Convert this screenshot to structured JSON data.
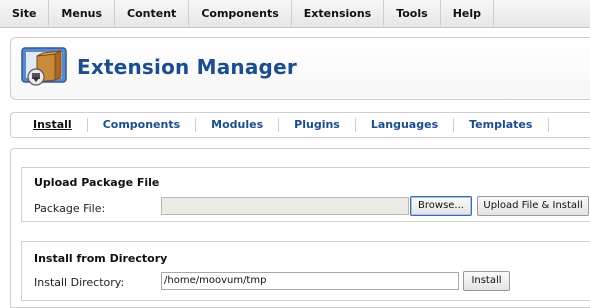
{
  "menubar": {
    "items": [
      "Site",
      "Menus",
      "Content",
      "Components",
      "Extensions",
      "Tools",
      "Help"
    ]
  },
  "header": {
    "title": "Extension Manager",
    "icon": "extension-box-icon"
  },
  "submenu": {
    "items": [
      "Install",
      "Components",
      "Modules",
      "Plugins",
      "Languages",
      "Templates"
    ],
    "active": "Install"
  },
  "upload": {
    "title": "Upload Package File",
    "label": "Package File:",
    "file_value": "",
    "browse_label": "Browse...",
    "submit_label": "Upload File & Install"
  },
  "directory": {
    "title": "Install from Directory",
    "label": "Install Directory:",
    "value": "/home/moovum/tmp",
    "submit_label": "Install"
  },
  "colors": {
    "title": "#1c4d8c",
    "link": "#1c4d8c",
    "file_input_bg": "#ecebe5"
  }
}
